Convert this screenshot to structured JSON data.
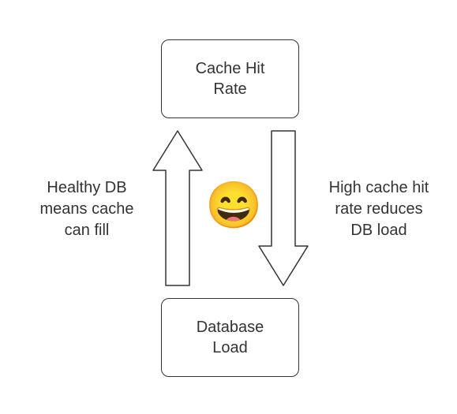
{
  "top_box": {
    "label": "Cache Hit\nRate"
  },
  "bottom_box": {
    "label": "Database\nLoad"
  },
  "left_label": "Healthy DB\nmeans cache\ncan fill",
  "right_label": "High cache hit\nrate reduces\nDB load",
  "emoji": "😄"
}
